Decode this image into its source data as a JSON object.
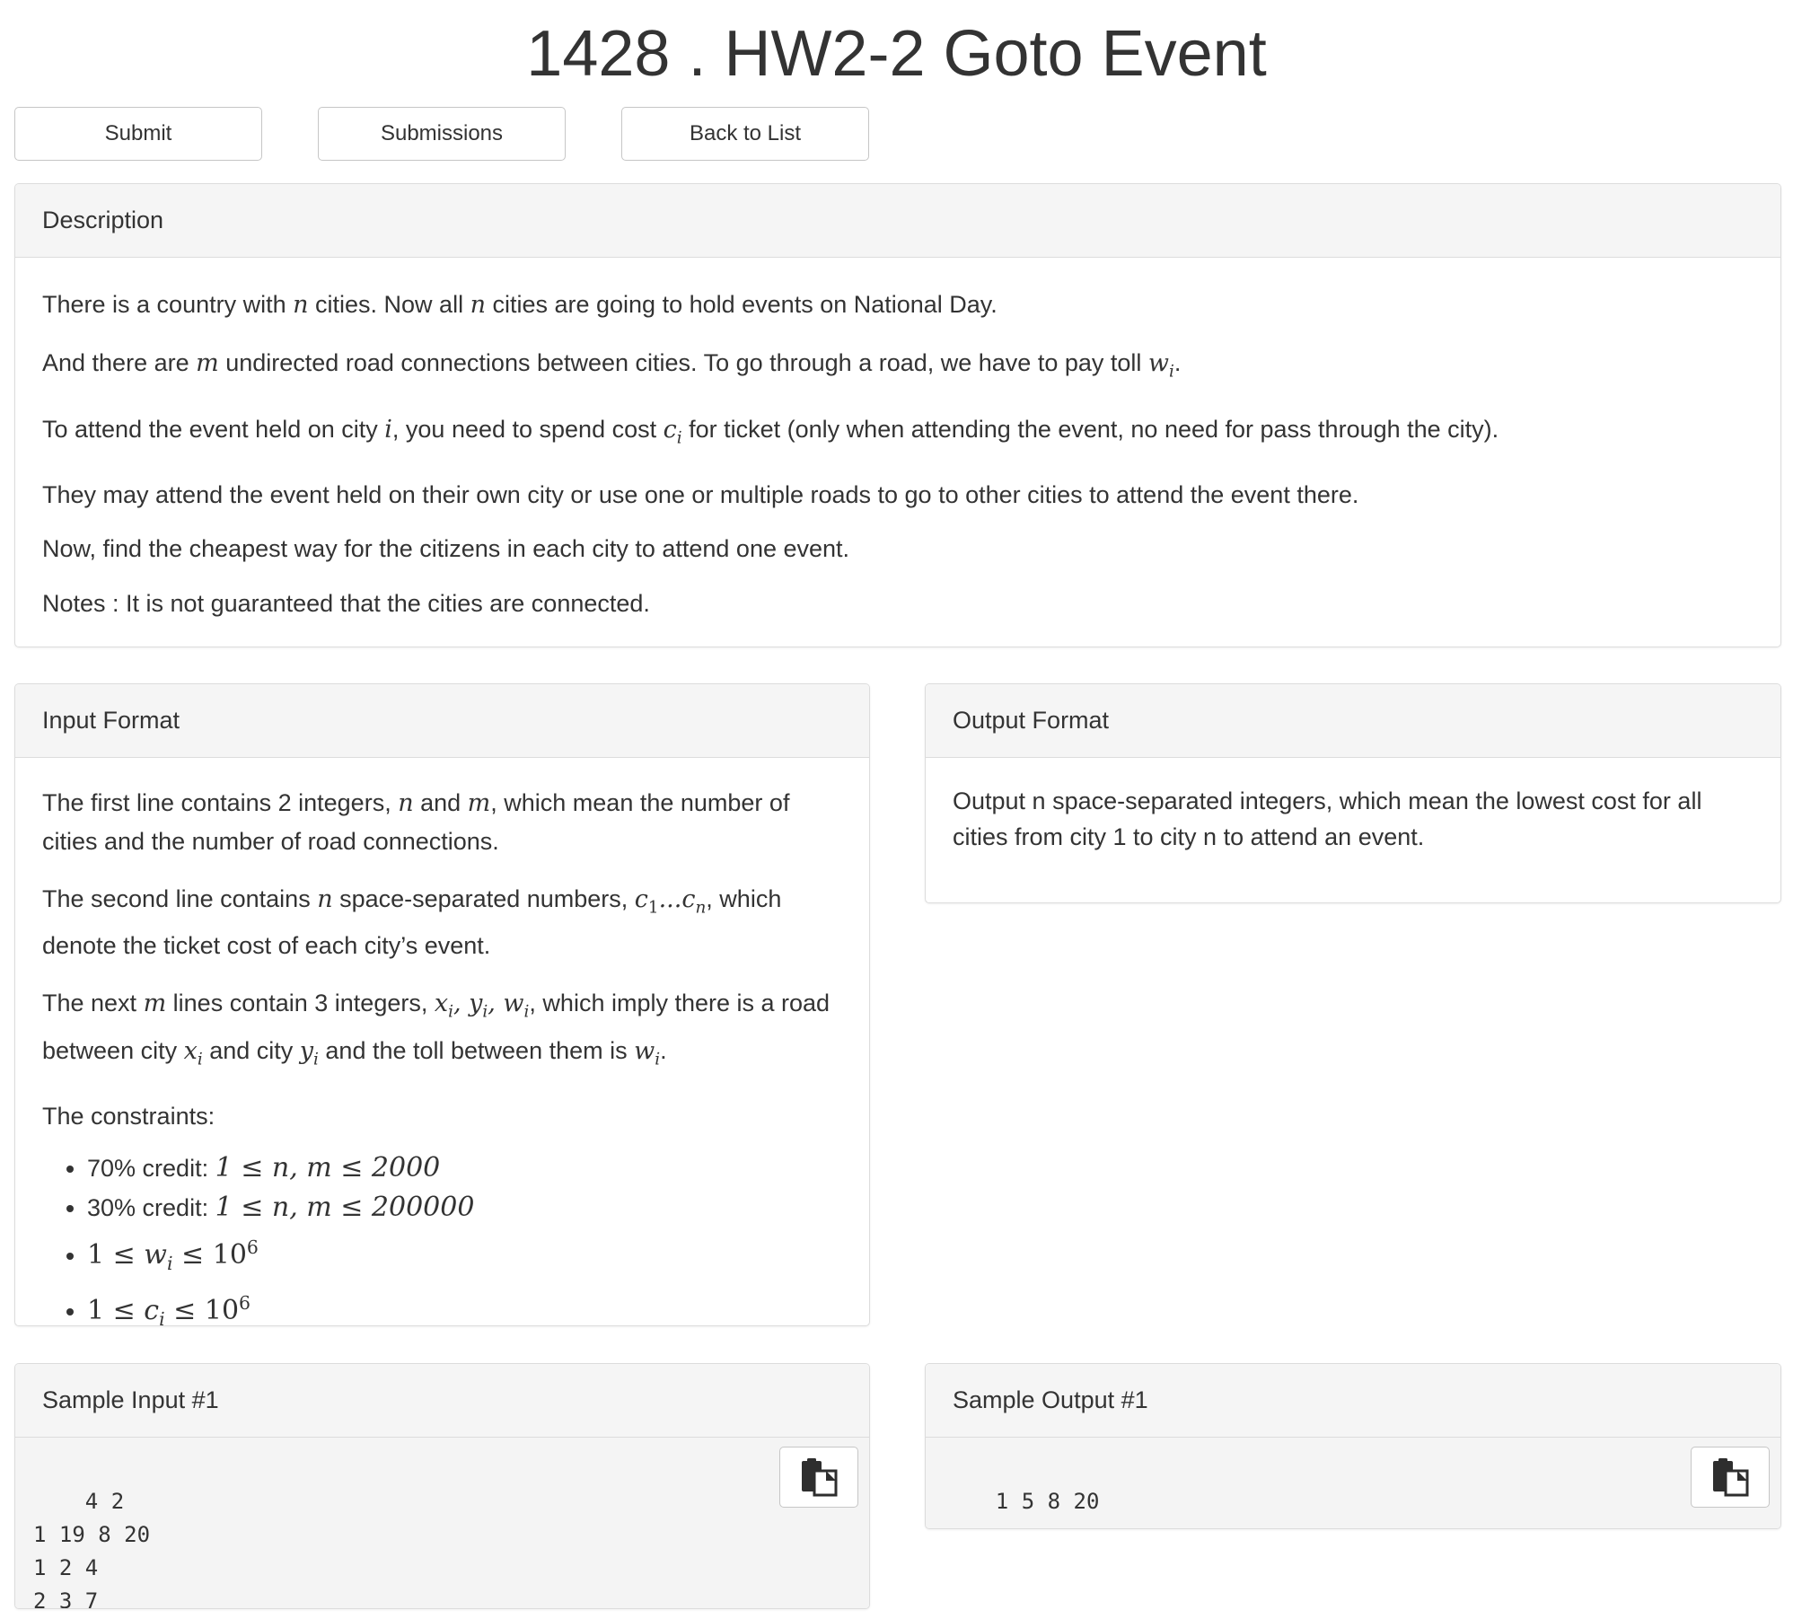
{
  "page_title": "1428 . HW2-2 Goto Event",
  "buttons": {
    "submit": "Submit",
    "submissions": "Submissions",
    "back": "Back to List"
  },
  "description": {
    "heading": "Description",
    "line1_a": "There is a country with ",
    "line1_b": " cities. Now all ",
    "line1_c": " cities are going to hold events on National Day.",
    "line2_a": "And there are ",
    "line2_b": " undirected road connections between cities. To go through a road, we have to pay toll ",
    "line2_c": ".",
    "line3_a": "To attend the event held on city ",
    "line3_b": ", you need to spend cost ",
    "line3_c": " for ticket (only when attending the event, no need for pass through the city).",
    "line4": "They may attend the event held on their own city or use one or multiple roads to go to other cities to attend the event there.",
    "line5": "Now, find the cheapest way for the citizens in each city to attend one event.",
    "line6": "Notes : It is not guaranteed that the cities are connected."
  },
  "input_format": {
    "heading": "Input Format",
    "p1_a": "The first line contains 2 integers, ",
    "p1_b": " and ",
    "p1_c": ", which mean the number of cities and the number of road connections.",
    "p2_a": "The second line contains ",
    "p2_b": " space-separated numbers, ",
    "p2_c": ", which denote the ticket cost of each city’s event.",
    "p3_a": "The next ",
    "p3_b": " lines contain 3 integers, ",
    "p3_c": ", which imply there is a road between city ",
    "p3_d": " and city ",
    "p3_e": " and the toll between them is ",
    "p3_f": ".",
    "constraints_label": "The constraints:",
    "c1_label": "70% credit: ",
    "c1_math": "1 ≤ n, m ≤ 2000",
    "c2_label": "30% credit: ",
    "c2_math": "1 ≤ n, m ≤ 200000"
  },
  "output_format": {
    "heading": "Output Format",
    "text": "Output n space-separated integers, which mean the lowest cost for all cities from city 1 to city n to attend an event."
  },
  "sample_input": {
    "heading": "Sample Input #1",
    "content": "4 2\n1 19 8 20\n1 2 4\n2 3 7"
  },
  "sample_output": {
    "heading": "Sample Output #1",
    "content": "1 5 8 20"
  },
  "icons": {
    "copy": "clipboard-copy-icon"
  }
}
